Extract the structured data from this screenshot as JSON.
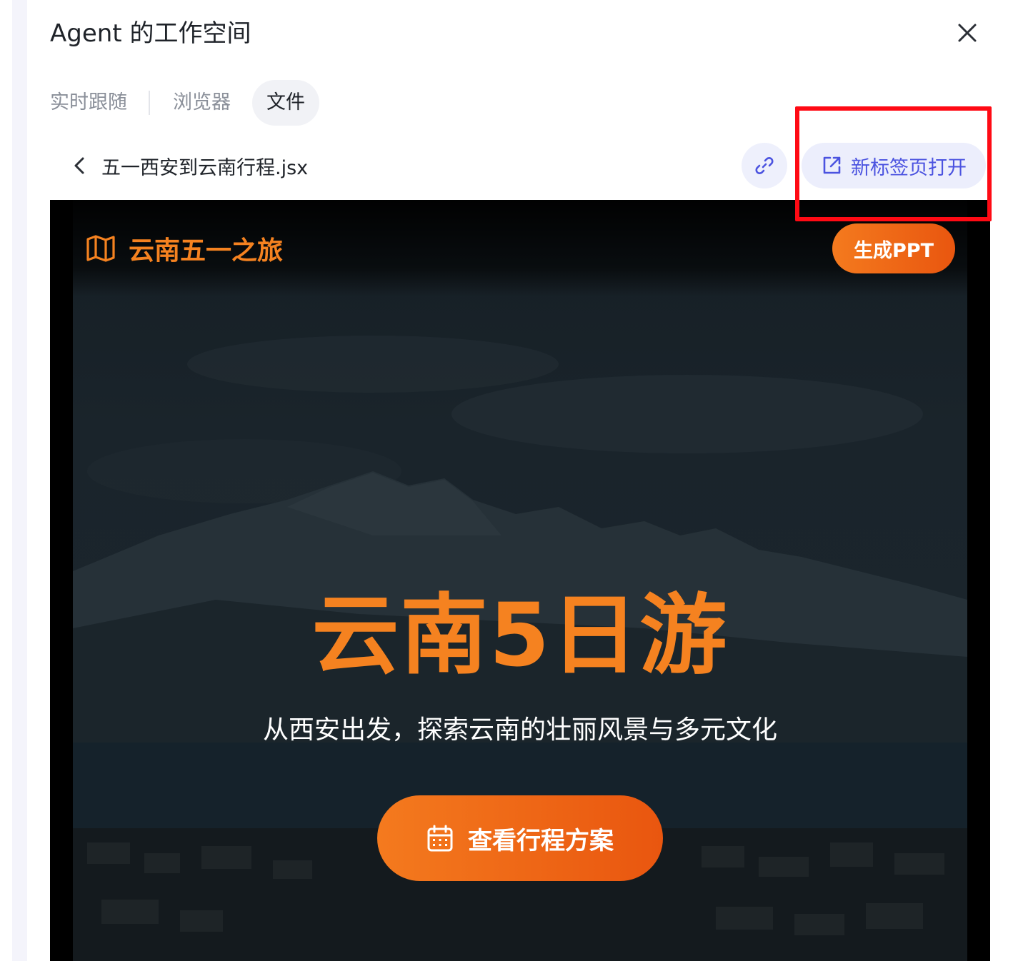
{
  "panel": {
    "title": "Agent 的工作空间",
    "close_icon": "close-icon"
  },
  "tabs": [
    {
      "label": "实时跟随",
      "active": false
    },
    {
      "label": "浏览器",
      "active": false
    },
    {
      "label": "文件",
      "active": true
    }
  ],
  "file_bar": {
    "back_icon": "chevron-left-icon",
    "file_name": "五一西安到云南行程.jsx",
    "link_icon": "link-icon",
    "open_in_new_tab_icon": "external-link-icon",
    "open_in_new_tab_label": "新标签页打开"
  },
  "preview": {
    "brand_icon": "map-icon",
    "brand_name": "云南五一之旅",
    "ppt_button_label": "生成PPT",
    "hero_title": "云南5日游",
    "hero_subtitle": "从西安出发，探索云南的壮丽风景与多元文化",
    "cta_icon": "calendar-icon",
    "cta_label": "查看行程方案"
  },
  "colors": {
    "accent_orange": "#f58220",
    "accent_blue": "#4b53e0",
    "highlight_red": "#ff0a14"
  }
}
